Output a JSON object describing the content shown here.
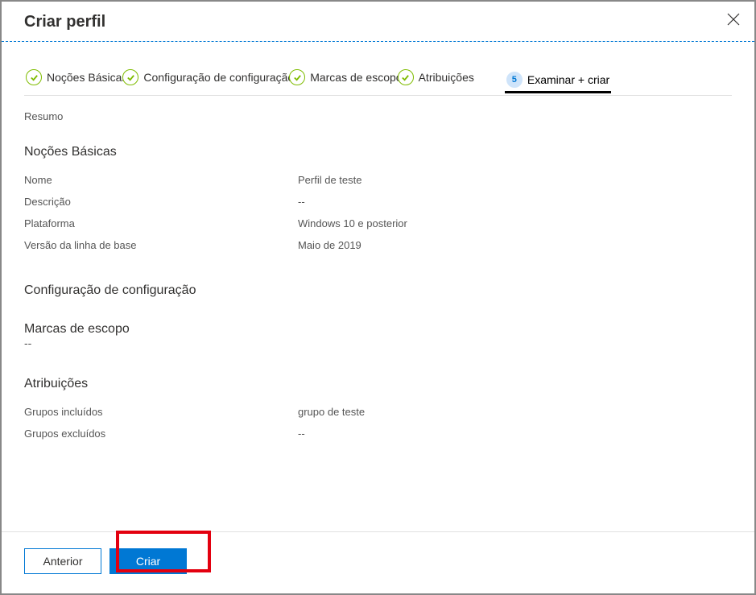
{
  "header": {
    "title": "Criar perfil"
  },
  "steps": [
    {
      "label": "Noções Básicas"
    },
    {
      "label": "Configuração de configuração"
    },
    {
      "label": "Marcas de escopo"
    },
    {
      "label": "Atribuições"
    },
    {
      "num": "5",
      "label": "Examinar + criar"
    }
  ],
  "summary": {
    "title": "Resumo"
  },
  "sections": {
    "basics": {
      "title": "Noções Básicas",
      "rows": [
        {
          "key": "Nome",
          "val": "Perfil de teste"
        },
        {
          "key": "Descrição",
          "val": "--"
        },
        {
          "key": "Plataforma",
          "val": "Windows 10 e posterior"
        },
        {
          "key": "Versão da linha de base",
          "val": "Maio de 2019"
        }
      ]
    },
    "config": {
      "title": "Configuração de configuração"
    },
    "scope": {
      "title": "Marcas de escopo",
      "val": "--"
    },
    "assign": {
      "title": "Atribuições",
      "rows": [
        {
          "key": "Grupos incluídos",
          "val": "grupo de teste"
        },
        {
          "key": "Grupos excluídos",
          "val": "--"
        }
      ]
    }
  },
  "footer": {
    "prev": "Anterior",
    "create": "Criar"
  }
}
